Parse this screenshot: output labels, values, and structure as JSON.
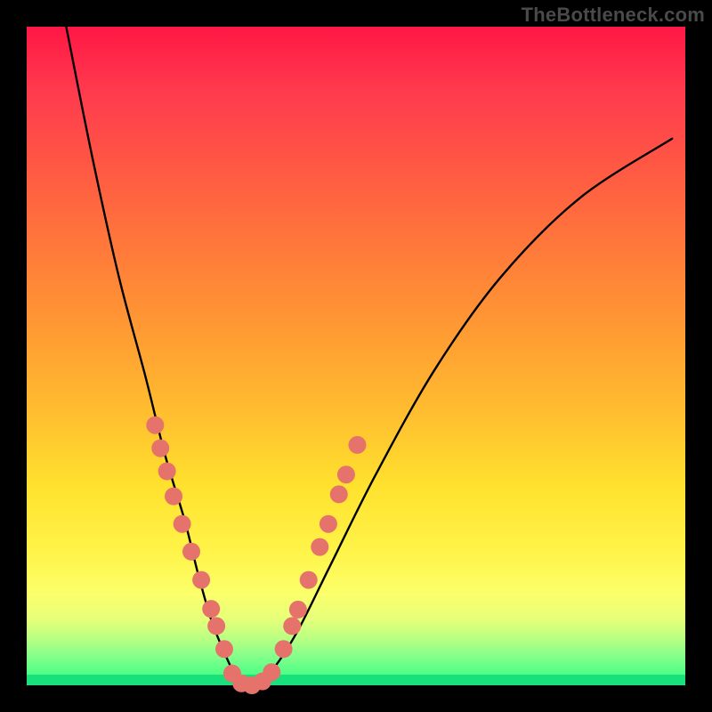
{
  "watermark": "TheBottleneck.com",
  "chart_data": {
    "type": "line",
    "title": "",
    "xlabel": "",
    "ylabel": "",
    "xlim": [
      0,
      1
    ],
    "ylim": [
      0,
      1
    ],
    "grid": false,
    "legend": false,
    "series": [
      {
        "name": "bottleneck-curve",
        "x": [
          0.06,
          0.1,
          0.14,
          0.18,
          0.21,
          0.24,
          0.26,
          0.28,
          0.3,
          0.32,
          0.34,
          0.37,
          0.41,
          0.46,
          0.53,
          0.62,
          0.72,
          0.84,
          0.98
        ],
        "y": [
          1.0,
          0.8,
          0.62,
          0.47,
          0.35,
          0.25,
          0.17,
          0.1,
          0.05,
          0.01,
          0.0,
          0.02,
          0.08,
          0.18,
          0.32,
          0.48,
          0.62,
          0.74,
          0.83
        ],
        "color": "#000000",
        "line_width": 2.4
      }
    ],
    "markers": [
      {
        "name": "left-branch-dots",
        "color": "#e5736b",
        "radius": 10,
        "points": [
          {
            "x": 0.195,
            "y": 0.395
          },
          {
            "x": 0.203,
            "y": 0.36
          },
          {
            "x": 0.213,
            "y": 0.325
          },
          {
            "x": 0.223,
            "y": 0.287
          },
          {
            "x": 0.236,
            "y": 0.245
          },
          {
            "x": 0.25,
            "y": 0.203
          },
          {
            "x": 0.265,
            "y": 0.16
          },
          {
            "x": 0.28,
            "y": 0.116
          },
          {
            "x": 0.288,
            "y": 0.09
          },
          {
            "x": 0.3,
            "y": 0.055
          }
        ]
      },
      {
        "name": "trough-dots",
        "color": "#e5736b",
        "radius": 10,
        "points": [
          {
            "x": 0.312,
            "y": 0.018
          },
          {
            "x": 0.326,
            "y": 0.003
          },
          {
            "x": 0.342,
            "y": 0.0
          },
          {
            "x": 0.358,
            "y": 0.006
          },
          {
            "x": 0.372,
            "y": 0.02
          }
        ]
      },
      {
        "name": "right-branch-dots",
        "color": "#e5736b",
        "radius": 10,
        "points": [
          {
            "x": 0.39,
            "y": 0.055
          },
          {
            "x": 0.403,
            "y": 0.09
          },
          {
            "x": 0.412,
            "y": 0.115
          },
          {
            "x": 0.428,
            "y": 0.16
          },
          {
            "x": 0.445,
            "y": 0.21
          },
          {
            "x": 0.458,
            "y": 0.245
          },
          {
            "x": 0.474,
            "y": 0.29
          },
          {
            "x": 0.485,
            "y": 0.32
          },
          {
            "x": 0.502,
            "y": 0.365
          }
        ]
      }
    ],
    "background_gradient": {
      "stops": [
        {
          "pos": 0.0,
          "color": "#ff1744"
        },
        {
          "pos": 0.5,
          "color": "#ffbc2f"
        },
        {
          "pos": 0.85,
          "color": "#fff44a"
        },
        {
          "pos": 1.0,
          "color": "#2bff7d"
        }
      ]
    }
  }
}
